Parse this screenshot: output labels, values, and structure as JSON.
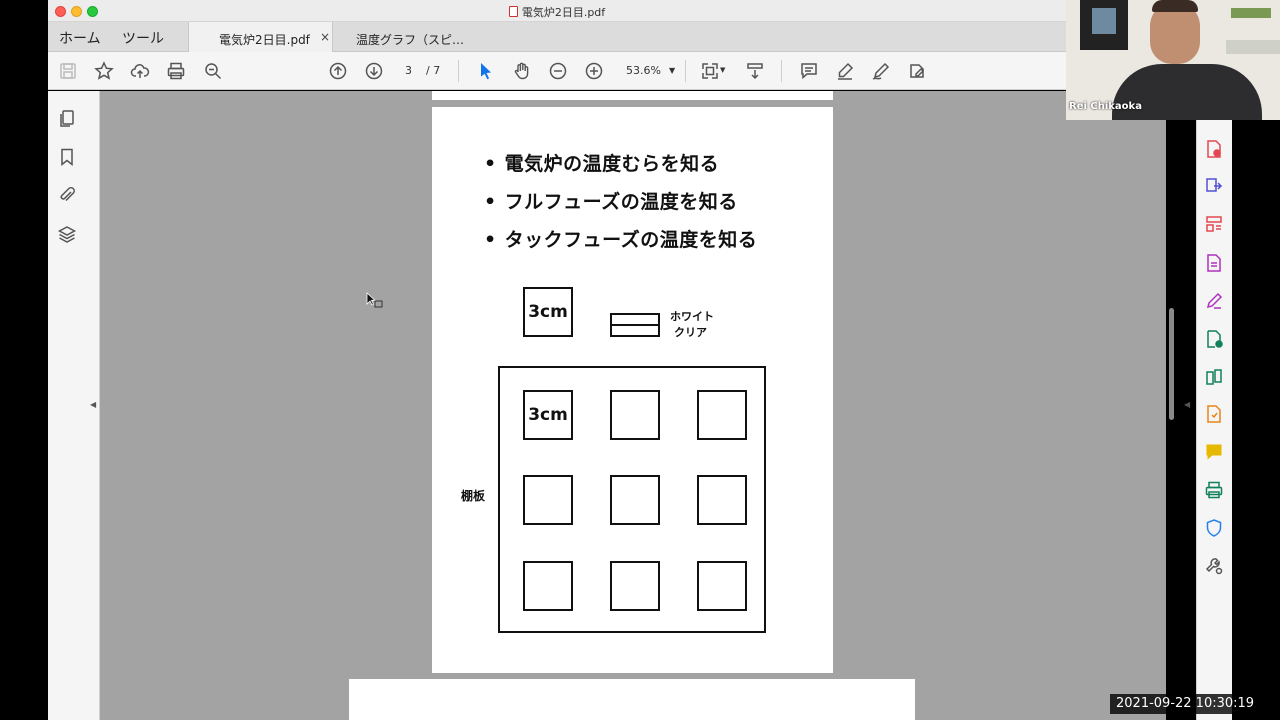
{
  "window": {
    "title": "電気炉2日目.pdf"
  },
  "menu_tabs": [
    "ホーム",
    "ツール"
  ],
  "doc_tabs": [
    {
      "label": "電気炉2日目.pdf",
      "close": "×"
    },
    {
      "label": "温度グラフ（スピ…"
    }
  ],
  "toolbar": {
    "current_page": "3",
    "page_total": "/ 7",
    "zoom": "53.6%"
  },
  "document": {
    "bullets": [
      "電気炉の温度むらを知る",
      "フルフューズの温度を知る",
      "タックフューズの温度を知る"
    ],
    "legend_box_label": "3cm",
    "legend_glass_line1": "ホワイト",
    "legend_glass_line2": "クリア",
    "grid_first_label": "3cm",
    "shelf_label": "棚板"
  },
  "webcam": {
    "participant": "Rei Chikaoka"
  },
  "timestamp": "2021-09-22  10:30:19",
  "colors": {
    "page_bg": "#ffffff",
    "doc_bg": "#a3a3a3",
    "toolbar_bg": "#f5f5f5",
    "select_tool": "#1473e6"
  }
}
